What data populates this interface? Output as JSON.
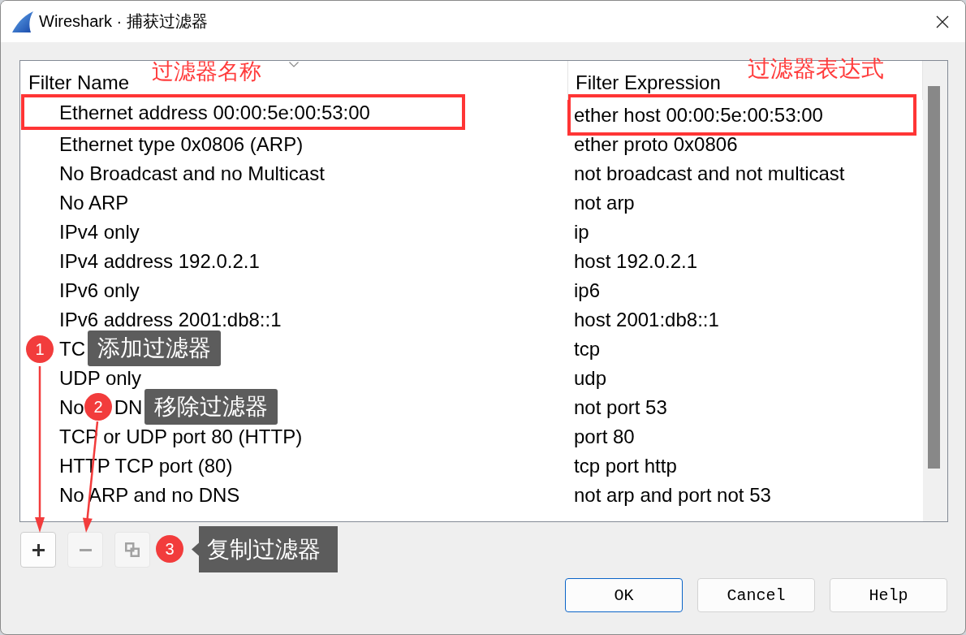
{
  "window": {
    "title": "Wireshark · 捕获过滤器"
  },
  "table": {
    "columns": [
      {
        "label": "Filter Name",
        "sorted": true
      },
      {
        "label": "Filter Expression",
        "sorted": false
      }
    ],
    "rows": [
      {
        "name": "Ethernet address 00:00:5e:00:53:00",
        "expression": "ether host 00:00:5e:00:53:00",
        "highlighted": true
      },
      {
        "name": "Ethernet type 0x0806 (ARP)",
        "expression": "ether proto 0x0806",
        "highlighted": false
      },
      {
        "name": "No Broadcast and no Multicast",
        "expression": "not broadcast and not multicast",
        "highlighted": false
      },
      {
        "name": "No ARP",
        "expression": "not arp",
        "highlighted": false
      },
      {
        "name": "IPv4 only",
        "expression": "ip",
        "highlighted": false
      },
      {
        "name": "IPv4 address 192.0.2.1",
        "expression": "host 192.0.2.1",
        "highlighted": false
      },
      {
        "name": "IPv6 only",
        "expression": "ip6",
        "highlighted": false
      },
      {
        "name": "IPv6 address 2001:db8::1",
        "expression": "host 2001:db8::1",
        "highlighted": false
      },
      {
        "name": "TC",
        "expression": "tcp",
        "highlighted": false
      },
      {
        "name": "UDP only",
        "expression": "udp",
        "highlighted": false
      },
      {
        "name": [
          "No",
          "DN"
        ],
        "expression": "not port 53",
        "highlighted": false
      },
      {
        "name": "TCP or UDP port 80 (HTTP)",
        "expression": "port 80",
        "highlighted": false
      },
      {
        "name": "HTTP TCP port (80)",
        "expression": "tcp port http",
        "highlighted": false
      },
      {
        "name": "No ARP and no DNS",
        "expression": "not arp and port not 53",
        "highlighted": false
      }
    ]
  },
  "toolbar": [
    {
      "kind": "add",
      "disabled": false
    },
    {
      "kind": "remove",
      "disabled": true
    },
    {
      "kind": "copy",
      "disabled": true
    }
  ],
  "buttons": [
    {
      "label": "OK",
      "default": true
    },
    {
      "label": "Cancel",
      "default": false
    },
    {
      "label": "Help",
      "default": false
    }
  ],
  "annotations": {
    "labels": [
      "过滤器名称",
      "过滤器表达式"
    ],
    "callouts": [
      {
        "number": "1",
        "text": "添加过滤器",
        "kind": "arrow"
      },
      {
        "number": "2",
        "text": "移除过滤器",
        "kind": "arrow"
      },
      {
        "number": "3",
        "text": "复制过滤器",
        "kind": "pointer"
      }
    ]
  }
}
